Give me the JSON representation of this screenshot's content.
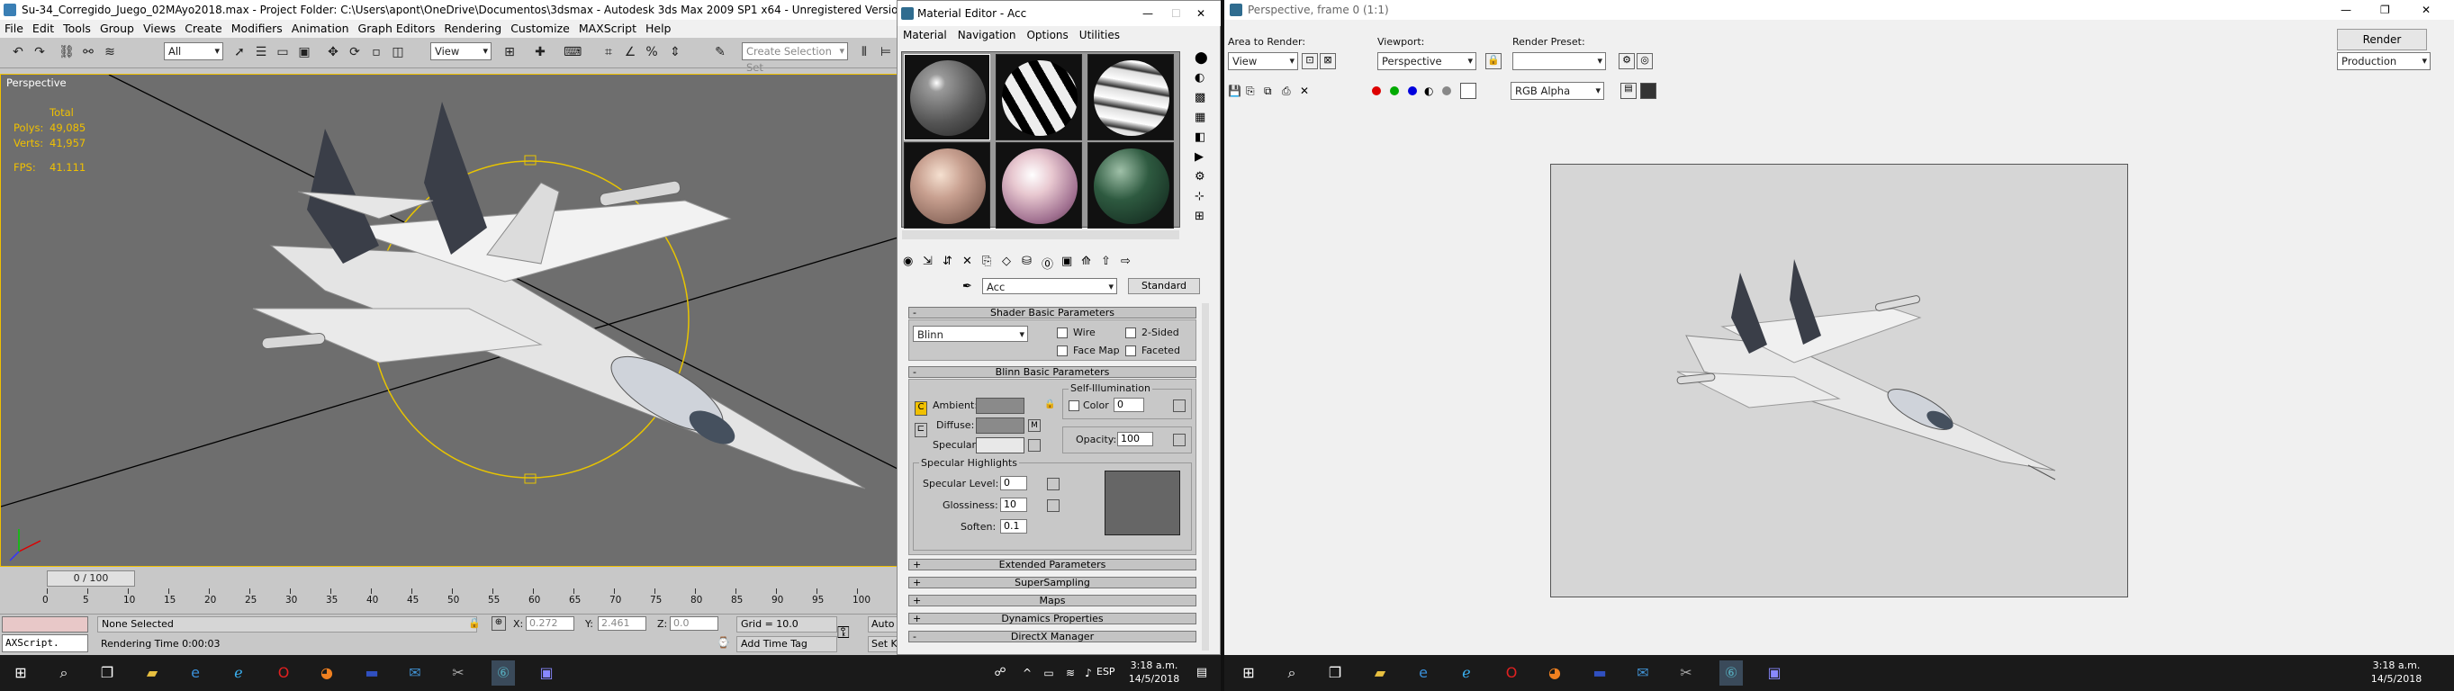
{
  "left_app": {
    "title": "Su-34_Corregido_Juego_02MAyo2018.max    - Project Folder: C:\\Users\\apont\\OneDrive\\Documentos\\3dsmax    - Autodesk 3ds Max  2009 SP1  x64    - Unregistered Version    - Display :",
    "menu": [
      "File",
      "Edit",
      "Tools",
      "Group",
      "Views",
      "Create",
      "Modifiers",
      "Animation",
      "Graph Editors",
      "Rendering",
      "Customize",
      "MAXScript",
      "Help"
    ],
    "filter_value": "All",
    "view_value": "View",
    "selection_set": "Create Selection Set",
    "viewport": {
      "label": "Perspective",
      "stats": {
        "header": "Total",
        "poly_label": "Polys:",
        "poly_value": "49,085",
        "verts_label": "Verts:",
        "verts_value": "41,957",
        "fps_label": "FPS:",
        "fps_value": "41.111"
      }
    },
    "timeline": {
      "frame": "0 / 100",
      "ticks": [
        "0",
        "5",
        "10",
        "15",
        "20",
        "25",
        "30",
        "35",
        "40",
        "45",
        "50",
        "55",
        "60",
        "65",
        "70",
        "75",
        "80",
        "85",
        "90",
        "95",
        "100"
      ]
    },
    "status": {
      "maxscript": "AXScript.",
      "none_selected": "None Selected",
      "render_time": "Rendering Time  0:00:03",
      "x_label": "X:",
      "x_value": "0.272",
      "y_label": "Y:",
      "y_value": "2.461",
      "z_label": "Z:",
      "z_value": "0.0",
      "grid": "Grid = 10.0",
      "add_time_tag": "Add Time Tag",
      "auto": "Auto",
      "set": "Set K"
    },
    "taskbar": {
      "time": "3:18 a.m.",
      "date": "14/5/2018",
      "lang": "ESP"
    }
  },
  "material_editor": {
    "title": "Material Editor - Acc",
    "menu": [
      "Material",
      "Navigation",
      "Options",
      "Utilities"
    ],
    "material_name": "Acc",
    "material_type": "Standard",
    "rollouts": {
      "shader_basic": "Shader Basic Parameters",
      "blinn_basic": "Blinn Basic Parameters",
      "extended": "Extended Parameters",
      "supersampling": "SuperSampling",
      "maps": "Maps",
      "dynamics": "Dynamics Properties",
      "directx": "DirectX Manager"
    },
    "shader": {
      "type": "Blinn",
      "wire": "Wire",
      "two_sided": "2-Sided",
      "face_map": "Face Map",
      "faceted": "Faceted"
    },
    "blinn": {
      "ambient": "Ambient:",
      "diffuse": "Diffuse:",
      "specular": "Specular:",
      "self_illum": "Self-Illumination",
      "color": "Color",
      "color_value": "0",
      "opacity": "Opacity:",
      "opacity_value": "100",
      "spec_highlights": "Specular Highlights",
      "spec_level": "Specular Level:",
      "spec_level_value": "0",
      "glossiness": "Glossiness:",
      "glossiness_value": "10",
      "soften": "Soften:",
      "soften_value": "0.1",
      "c": "C",
      "m": "M"
    },
    "slot_colors": [
      "#6a6a6a",
      "#bbbbbb",
      "#dddddd",
      "#c8a090",
      "#e8c8d0",
      "#2e5a40"
    ]
  },
  "render_window": {
    "title": "Perspective, frame 0 (1:1)",
    "area_label": "Area to Render:",
    "area_value": "View",
    "viewport_label": "Viewport:",
    "viewport_value": "Perspective",
    "preset_label": "Render Preset:",
    "preset_value": "",
    "render_button": "Render",
    "production": "Production",
    "channel": "RGB Alpha",
    "taskbar": {
      "time": "3:18 a.m.",
      "date": "14/5/2018"
    }
  }
}
